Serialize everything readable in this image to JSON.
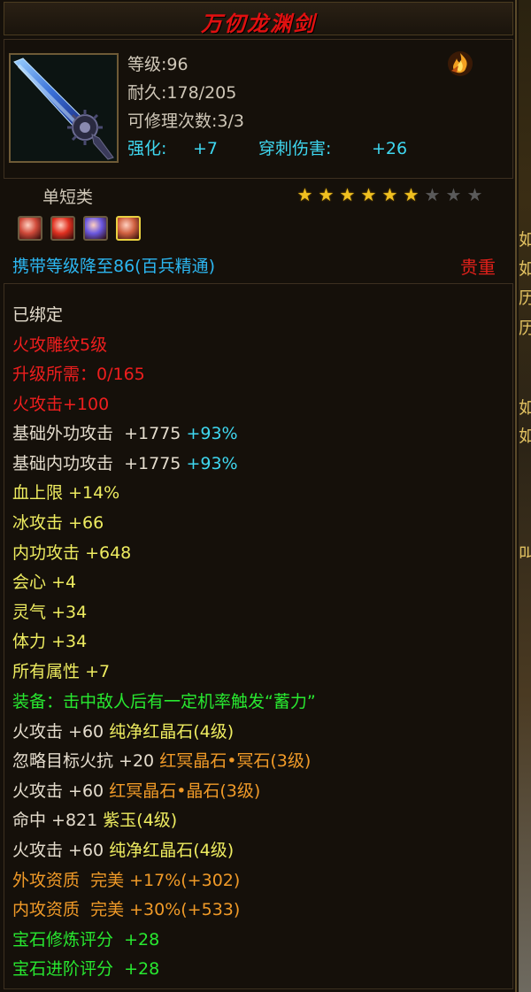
{
  "title": "万仞龙渊剑",
  "header": {
    "level": "等级:96",
    "durability": "耐久:178/205",
    "repairs": "可修理次数:3/3",
    "enhance_label": "强化:",
    "enhance_value": "+7",
    "pierce_label": "穿刺伤害:",
    "pierce_value": "+26",
    "element_icon": "fire-element-icon"
  },
  "category": "单短类",
  "stars": {
    "lit": 6,
    "total": 9
  },
  "gem_slots": [
    {
      "icon": "red-gem-icon",
      "color": "#d04a3a"
    },
    {
      "icon": "fire-gem-icon",
      "color": "#e03020"
    },
    {
      "icon": "purple-gem-icon",
      "color": "#6a58e0"
    },
    {
      "icon": "red-gem-icon",
      "color": "#d06040"
    }
  ],
  "carry_level": "携带等级降至86(百兵精通)",
  "precious": "贵重",
  "side_fragments": [
    "如",
    "如",
    "历",
    "历",
    "如",
    "如",
    "叫"
  ],
  "attributes": {
    "bound": "已绑定",
    "engrave": "火攻雕纹5级",
    "upgrade": "升级所需：0/165",
    "fire_atk": "火攻击+100",
    "ext_atk_label": "基础外功攻击",
    "ext_atk_value": "+1775",
    "ext_atk_pct": "+93%",
    "int_atk_label": "基础内功攻击",
    "int_atk_value": "+1775",
    "int_atk_pct": "+93%",
    "hp_label": "血上限",
    "hp_value": "+14%",
    "ice_label": "冰攻击",
    "ice_value": "+66",
    "inner_label": "内功攻击",
    "inner_value": "+648",
    "crit_label": "会心",
    "crit_value": "+4",
    "spirit_label": "灵气",
    "spirit_value": "+34",
    "stamina_label": "体力",
    "stamina_value": "+34",
    "all_label": "所有属性",
    "all_value": "+7",
    "equip_effect": "装备：击中敌人后有一定机率触发“蓄力”",
    "gem1_stat": "火攻击 +60",
    "gem1_name": "纯净红晶石(4级)",
    "gem2_stat": "忽略目标火抗 +20",
    "gem2_name": "红冥晶石•冥石(3级)",
    "gem3_stat": "火攻击 +60",
    "gem3_name": "红冥晶石•晶石(3级)",
    "gem4_stat": "命中 +821",
    "gem4_name": "紫玉(4级)",
    "gem5_stat": "火攻击 +60",
    "gem5_name": "纯净红晶石(4级)",
    "ext_quality": "外攻资质  完美 +17%(+302)",
    "int_quality": "内攻资质  完美 +30%(+533)",
    "refine_score": "宝石修炼评分  +28",
    "advance_score": "宝石进阶评分  +28"
  },
  "colors": {
    "title": "#e01010",
    "white": "#e4dccd",
    "red": "#ee1e1e",
    "yellow": "#eeec60",
    "cyan": "#3fd7f0",
    "green": "#28e830",
    "orange": "#f09a28",
    "carry_blue": "#2cb6f0"
  }
}
